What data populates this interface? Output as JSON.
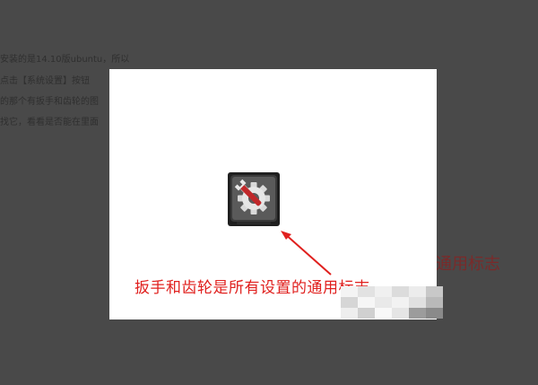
{
  "background_doc": {
    "lines": [
      "安装的是14.10版ubuntu，所以",
      "点击【系统设置】按钮",
      "的那个有扳手和齿轮的图",
      "找它，看看是否能在里面"
    ],
    "side_caption": "通用标志"
  },
  "modal": {
    "icon": "settings-gear-wrench-icon",
    "caption": "扳手和齿轮是所有设置的通用标志"
  },
  "colors": {
    "overlay": "#494949",
    "modal_bg": "#ffffff",
    "annotation": "#e0201e"
  }
}
